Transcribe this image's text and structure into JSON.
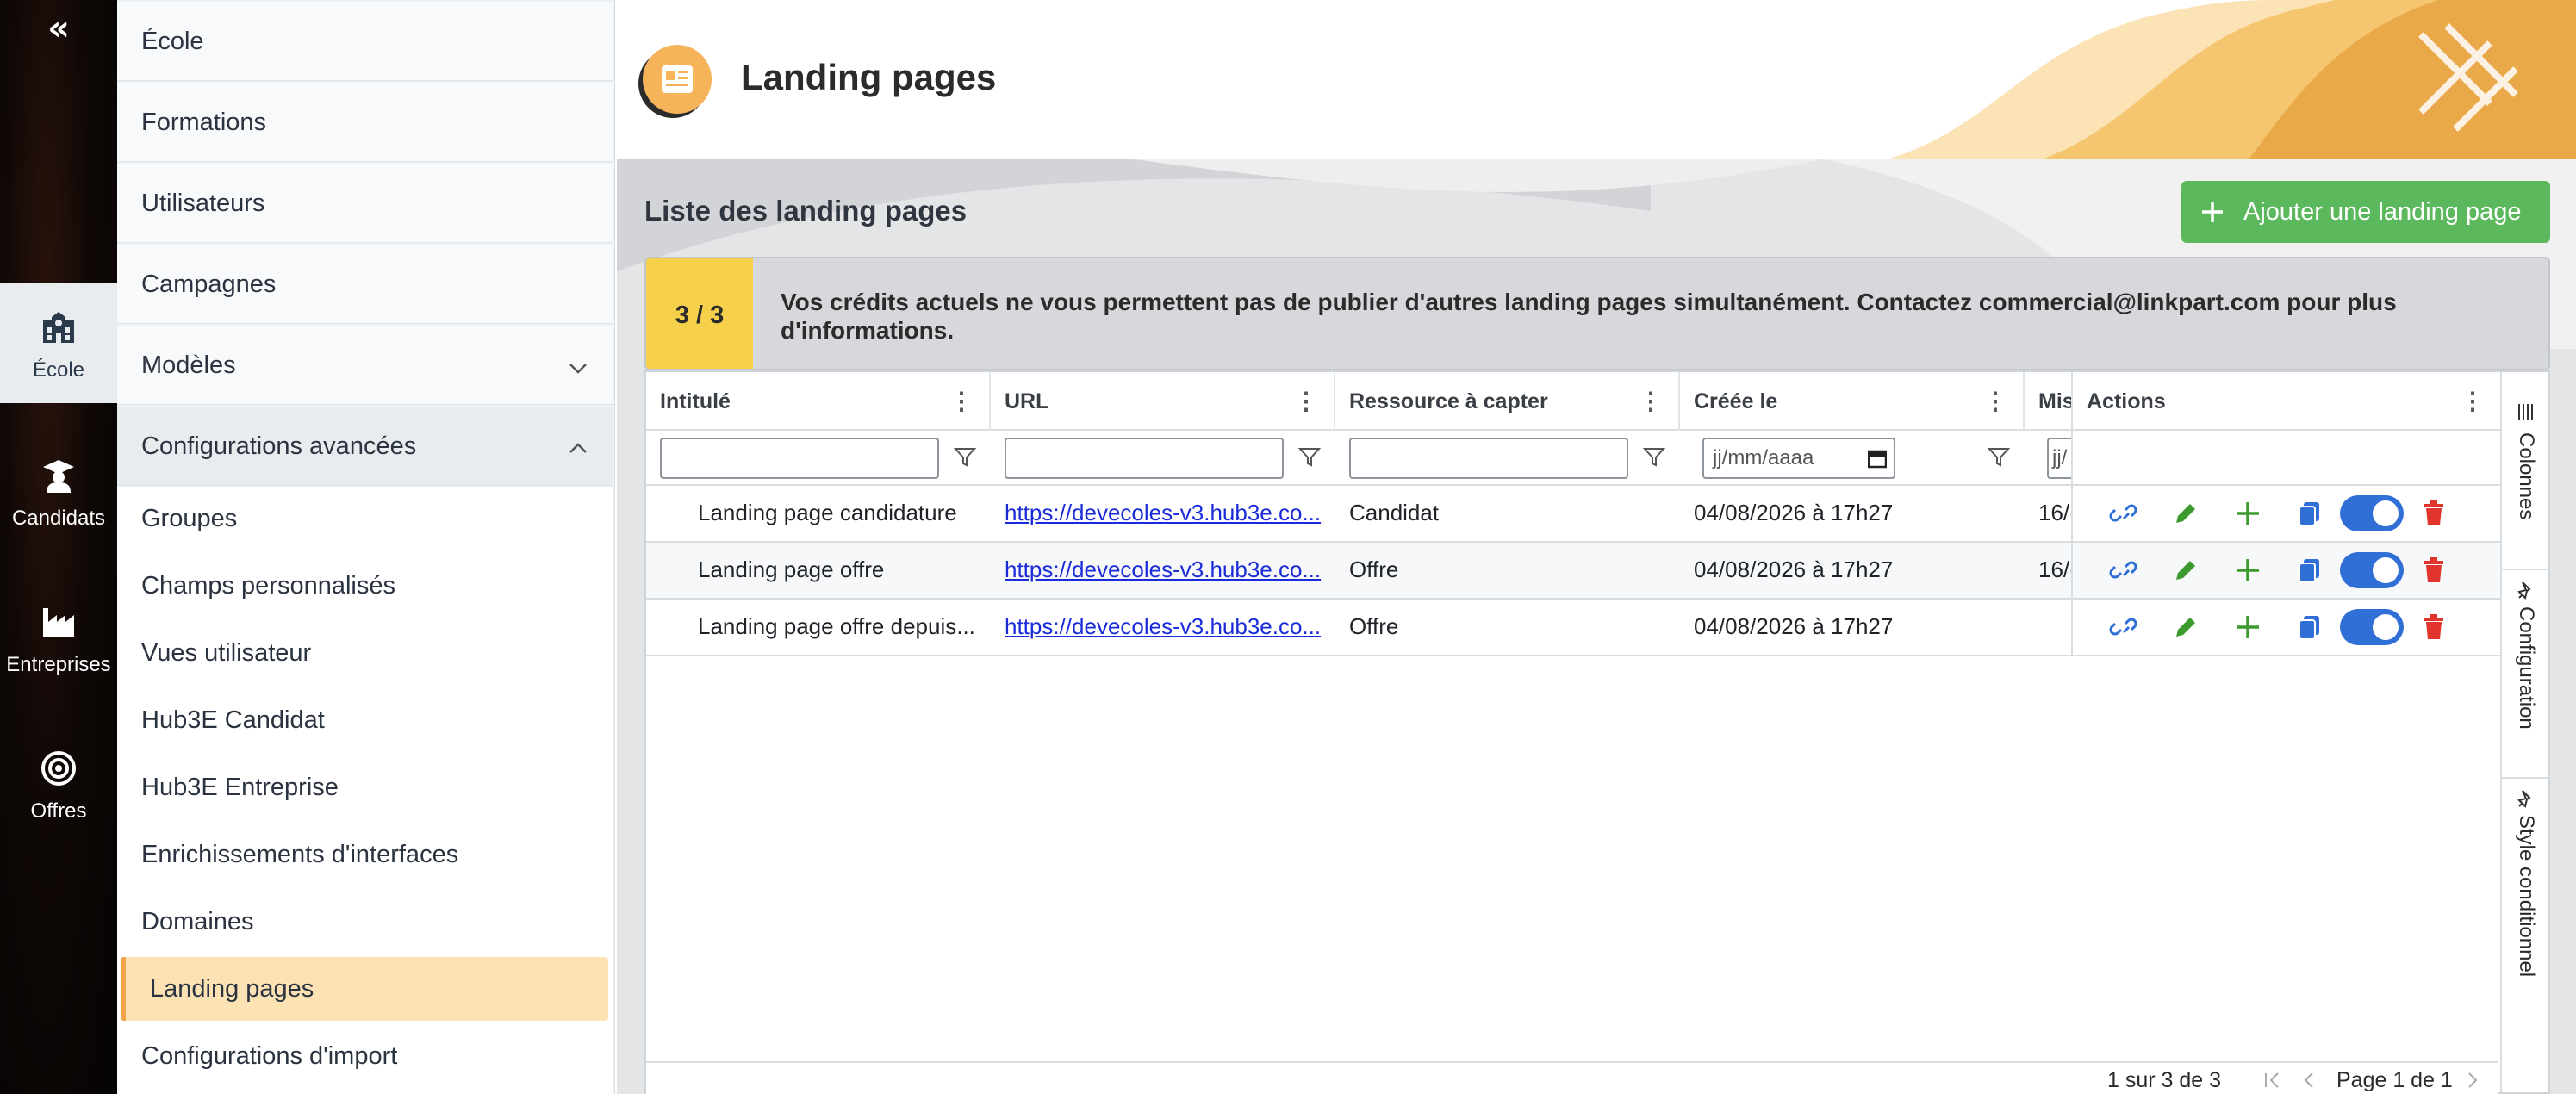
{
  "rail": {
    "collapse_glyph": "«",
    "items": [
      {
        "label": "École",
        "icon": "school-icon"
      },
      {
        "label": "Candidats",
        "icon": "graduate-icon"
      },
      {
        "label": "Entreprises",
        "icon": "factory-icon"
      },
      {
        "label": "Offres",
        "icon": "target-icon"
      }
    ]
  },
  "sidebar": {
    "items": [
      {
        "label": "École"
      },
      {
        "label": "Formations"
      },
      {
        "label": "Utilisateurs"
      },
      {
        "label": "Campagnes"
      },
      {
        "label": "Modèles"
      },
      {
        "label": "Configurations avancées"
      }
    ],
    "subitems": [
      {
        "label": "Groupes"
      },
      {
        "label": "Champs personnalisés"
      },
      {
        "label": "Vues utilisateur"
      },
      {
        "label": "Hub3E Candidat"
      },
      {
        "label": "Hub3E Entreprise"
      },
      {
        "label": "Enrichissements d'interfaces"
      },
      {
        "label": "Domaines"
      },
      {
        "label": "Landing pages"
      },
      {
        "label": "Configurations d'import"
      }
    ]
  },
  "header": {
    "title": "Landing pages"
  },
  "list": {
    "title": "Liste des landing pages",
    "add_button": "Ajouter une landing page"
  },
  "credits": {
    "count": "3 / 3",
    "message": "Vos crédits actuels ne vous permettent pas de publier d'autres landing pages simultanément. Contactez commercial@linkpart.com pour plus d'informations."
  },
  "grid": {
    "columns": [
      "Intitulé",
      "URL",
      "Ressource à capter",
      "Créée le",
      "Mis",
      "Actions"
    ],
    "column_menu_glyph": "⋮",
    "date_placeholder": "jj/mm/aaaa",
    "truncated_filter": "jj/",
    "rows": [
      {
        "title": "Landing page candidature",
        "url": "https://devecoles-v3.hub3e.co...",
        "resource": "Candidat",
        "created": "04/08/2026 à 17h27",
        "modified": "16/("
      },
      {
        "title": "Landing page offre",
        "url": "https://devecoles-v3.hub3e.co...",
        "resource": "Offre",
        "created": "04/08/2026 à 17h27",
        "modified": "16/("
      },
      {
        "title": "Landing page offre depuis...",
        "url": "https://devecoles-v3.hub3e.co...",
        "resource": "Offre",
        "created": "04/08/2026 à 17h27",
        "modified": ""
      }
    ],
    "side_tabs": [
      "Colonnes",
      "Configuration",
      "Style conditionnel"
    ],
    "pagination": {
      "range": "1 sur 3 de 3",
      "page": "Page 1 de 1"
    }
  },
  "colors": {
    "accent": "#f0a34a",
    "success": "#5cb85c",
    "link": "#1a2bd8",
    "toggle": "#2f6fd6",
    "delete": "#e0342c",
    "edit": "#3c9a2e"
  }
}
